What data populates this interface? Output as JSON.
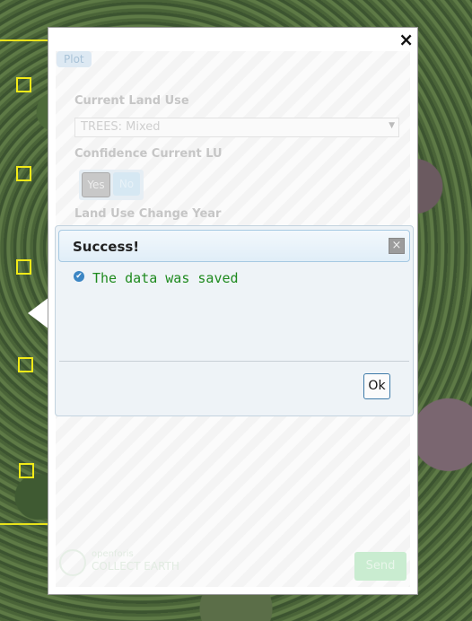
{
  "form": {
    "tab_label": "Plot",
    "current_land_use_label": "Current Land Use",
    "current_land_use_value": "TREES: Mixed",
    "confidence_label": "Confidence Current LU",
    "yes_label": "Yes",
    "no_label": "No",
    "change_year_label": "Land Use Change Year",
    "send_label": "Send",
    "logo_top": "openforis",
    "logo_bottom": "COLLECT EARTH",
    "close_glyph": "×"
  },
  "dialog": {
    "title": "Success!",
    "message": "The data was saved",
    "ok_label": "Ok",
    "close_glyph": "×",
    "message_icon": "check-circle-icon"
  },
  "colors": {
    "success_text": "#1e8a1e",
    "marker_yellow": "#f2ea18"
  }
}
